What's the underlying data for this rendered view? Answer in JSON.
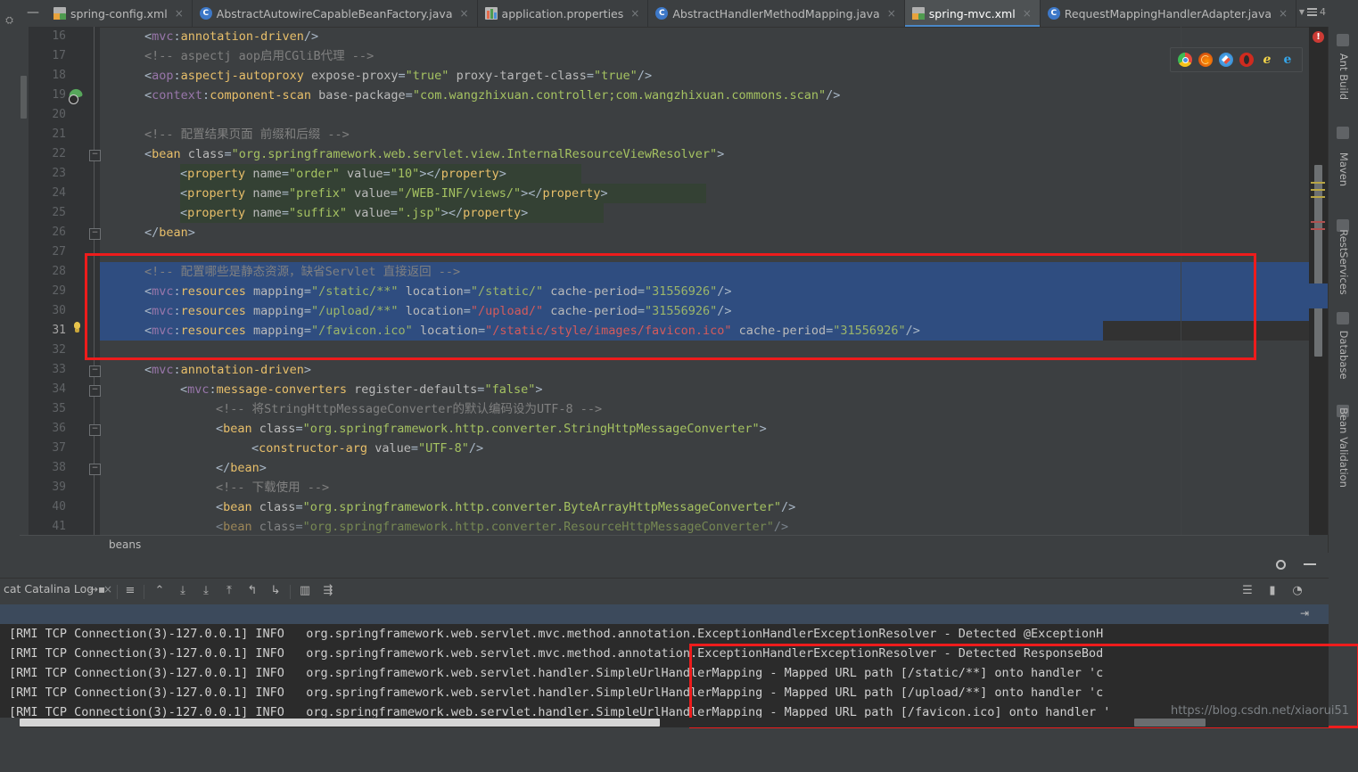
{
  "window": {
    "minimize_label": "—",
    "tab_overflow_count": "4"
  },
  "tabs": [
    {
      "label": "spring-config.xml",
      "icon": "xml-file-icon",
      "active": false,
      "close": "×"
    },
    {
      "label": "AbstractAutowireCapableBeanFactory.java",
      "icon": "java-class-icon",
      "active": false,
      "close": "×"
    },
    {
      "label": "application.properties",
      "icon": "properties-file-icon",
      "active": false,
      "close": "×"
    },
    {
      "label": "AbstractHandlerMethodMapping.java",
      "icon": "java-class-icon",
      "active": false,
      "close": "×"
    },
    {
      "label": "spring-mvc.xml",
      "icon": "xml-file-icon",
      "active": true,
      "close": "×"
    },
    {
      "label": "RequestMappingHandlerAdapter.java",
      "icon": "java-class-icon",
      "active": false,
      "close": "×"
    }
  ],
  "editor": {
    "breadcrumb": "beans",
    "first_line": 16,
    "current_line": 31,
    "line_numbers": [
      "16",
      "17",
      "18",
      "19",
      "20",
      "21",
      "22",
      "23",
      "24",
      "25",
      "26",
      "27",
      "28",
      "29",
      "30",
      "31",
      "32",
      "33",
      "34",
      "35",
      "36",
      "37",
      "38",
      "39",
      "40",
      "41"
    ],
    "lines": [
      {
        "n": "16",
        "text": "<mvc:annotation-driven/>"
      },
      {
        "n": "17",
        "text": "<!-- aspectj aop启用CGliB代理 -->"
      },
      {
        "n": "18",
        "text": "<aop:aspectj-autoproxy expose-proxy=\"true\" proxy-target-class=\"true\"/>"
      },
      {
        "n": "19",
        "text": "<context:component-scan base-package=\"com.wangzhixuan.controller;com.wangzhixuan.commons.scan\"/>"
      },
      {
        "n": "20",
        "text": ""
      },
      {
        "n": "21",
        "text": "<!-- 配置结果页面 前缀和后缀 -->"
      },
      {
        "n": "22",
        "text": "<bean class=\"org.springframework.web.servlet.view.InternalResourceViewResolver\">"
      },
      {
        "n": "23",
        "text": "<property name=\"order\" value=\"10\"></property>"
      },
      {
        "n": "24",
        "text": "<property name=\"prefix\" value=\"/WEB-INF/views/\"></property>"
      },
      {
        "n": "25",
        "text": "<property name=\"suffix\" value=\".jsp\"></property>"
      },
      {
        "n": "26",
        "text": "</bean>"
      },
      {
        "n": "27",
        "text": ""
      },
      {
        "n": "28",
        "text": "<!-- 配置哪些是静态资源，缺省Servlet 直接返回 -->"
      },
      {
        "n": "29",
        "text": "<mvc:resources mapping=\"/static/**\" location=\"/static/\" cache-period=\"31556926\"/>"
      },
      {
        "n": "30",
        "text": "<mvc:resources mapping=\"/upload/**\" location=\"/upload/\" cache-period=\"31556926\"/>"
      },
      {
        "n": "31",
        "text": "<mvc:resources mapping=\"/favicon.ico\" location=\"/static/style/images/favicon.ico\" cache-period=\"31556926\"/>"
      },
      {
        "n": "32",
        "text": ""
      },
      {
        "n": "33",
        "text": "<mvc:annotation-driven>"
      },
      {
        "n": "34",
        "text": "<mvc:message-converters register-defaults=\"false\">"
      },
      {
        "n": "35",
        "text": "<!-- 将StringHttpMessageConverter的默认编码设为UTF-8 -->"
      },
      {
        "n": "36",
        "text": "<bean class=\"org.springframework.http.converter.StringHttpMessageConverter\">"
      },
      {
        "n": "37",
        "text": "<constructor-arg value=\"UTF-8\"/>"
      },
      {
        "n": "38",
        "text": "</bean>"
      },
      {
        "n": "39",
        "text": "<!-- 下载使用 -->"
      },
      {
        "n": "40",
        "text": "<bean class=\"org.springframework.http.converter.ByteArrayHttpMessageConverter\"/>"
      },
      {
        "n": "41",
        "text": "<bean class=\"org.springframework.http.converter.ResourceHttpMessageConverter\"/>"
      }
    ],
    "browsers": [
      "chrome-icon",
      "firefox-icon",
      "safari-icon",
      "opera-icon",
      "internet-explorer-icon",
      "edge-icon"
    ],
    "error_badge": "!"
  },
  "right_rail": [
    {
      "label": "Ant Build",
      "icon": "ant-icon"
    },
    {
      "label": "Maven",
      "icon": "maven-icon"
    },
    {
      "label": "RestServices",
      "icon": "rest-services-icon"
    },
    {
      "label": "Database",
      "icon": "database-icon"
    },
    {
      "label": "Bean Validation",
      "icon": "bean-validation-icon"
    }
  ],
  "console": {
    "tab_label": "cat Catalina Log",
    "tab_pin": "→▪",
    "tab_close": "×",
    "toolbar_icons": [
      "menu-icon",
      "scroll-to-top-icon",
      "scroll-down-icon",
      "soft-wrap-icon",
      "scroll-up-icon",
      "previous-occurrence-icon",
      "next-occurrence-icon",
      "print-icon",
      "clear-all-icon"
    ],
    "right_icons": [
      "align-icon",
      "layout-icon",
      "gauge-icon"
    ],
    "gear_icon": "gear-icon",
    "minimize_icon": "minimize-icon",
    "lines": [
      "[RMI TCP Connection(3)-127.0.0.1] INFO   org.springframework.web.servlet.mvc.method.annotation.ExceptionHandlerExceptionResolver - Detected @ExceptionH",
      "[RMI TCP Connection(3)-127.0.0.1] INFO   org.springframework.web.servlet.mvc.method.annotation.ExceptionHandlerExceptionResolver - Detected ResponseBod",
      "[RMI TCP Connection(3)-127.0.0.1] INFO   org.springframework.web.servlet.handler.SimpleUrlHandlerMapping - Mapped URL path [/static/**] onto handler 'c",
      "[RMI TCP Connection(3)-127.0.0.1] INFO   org.springframework.web.servlet.handler.SimpleUrlHandlerMapping - Mapped URL path [/upload/**] onto handler 'c",
      "[RMI TCP Connection(3)-127.0.0.1] INFO   org.springframework.web.servlet.handler.SimpleUrlHandlerMapping - Mapped URL path [/favicon.ico] onto handler '"
    ]
  },
  "watermark": "https://blog.csdn.net/xiaorui51",
  "colors": {
    "editor_bg": "#2b2b2b",
    "panel_bg": "#3c3f41",
    "selection_blue": "#2f4d80",
    "highlight_olive": "#344134",
    "accent_red": "#ee1c1c",
    "tab_active_underline": "#4a88c7"
  }
}
